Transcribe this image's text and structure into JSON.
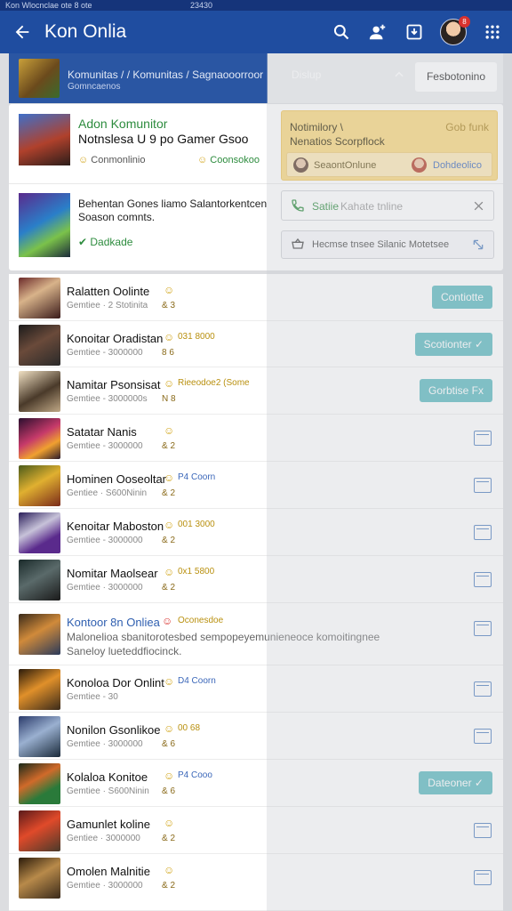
{
  "statusbar": {
    "left": "Kon Wlocnclae ote 8 ote",
    "center": "23430"
  },
  "appbar": {
    "title": "Kon Onlia",
    "notif_count": "8"
  },
  "crumb": {
    "line1": "Komunitas / / Komunitas / Sagnaooorroor",
    "line2": "Gomncaenos",
    "display": "Dislup",
    "button": "Fesbotonino"
  },
  "card": {
    "title_green": "Adon Komunitor",
    "title_main": "Notnslesa U 9 po Gamer Gsoo",
    "status_left": "Conmonlinio",
    "status_right": "Coonsokoo",
    "desc1": "Behentan Gones liamo Salantorkentcen",
    "desc2": "Soason comnts.",
    "ok_label": "Dadkade",
    "notice_title": "Notimilory \\",
    "notice_body": "Nenatios Scorpflock",
    "notice_right": "Gob funk",
    "notice_a": "SeaontOnlune",
    "notice_b": "Dohdeolico",
    "field_label": "Satiie",
    "field_value": "Kahate tnline",
    "field2_label": "Hecmse tnsee Silanic Motetsee"
  },
  "rows": [
    {
      "name": "Ralatten Oolinte",
      "meta": "Gemtiee · 2 Stotinita",
      "stat": "& 3",
      "badge": "",
      "action": "Contiotte"
    },
    {
      "name": "Konoitar Oradistan",
      "meta": "Gemtiee - 3000000",
      "stat": "8 6",
      "badge": "031 8000",
      "action": "Scotionter ✓"
    },
    {
      "name": "Namitar Psonsisat",
      "meta": "Gemtiee - 3000000s",
      "stat": "N 8",
      "badge": "Rieeodoe2 (Some",
      "action": "Gorbtise Fx"
    },
    {
      "name": "Satatar Nanis",
      "meta": "Gemtiee - 3000000",
      "stat": "& 2",
      "badge": "",
      "action": ""
    },
    {
      "name": "Hominen Ooseoltar",
      "meta": "Gentiee · S600Ninin",
      "stat": "& 2",
      "badge": "P4 Coorn",
      "action": ""
    },
    {
      "name": "Kenoitar Maboston",
      "meta": "Gemtiee - 3000000",
      "stat": "& 2",
      "badge": "001 3000",
      "action": ""
    },
    {
      "name": "Nomitar Maolsear",
      "meta": "Gemtiee · 3000000",
      "stat": "& 2",
      "badge": "0x1 5800",
      "action": ""
    },
    {
      "name": "Kontoor 8n Onliea",
      "meta": "Malonelioa sbanitorotesbed sempopeyemunieneoce komoitingnee",
      "meta2": "Saneloy lueteddfiocinck.",
      "stat": "",
      "badge": "Oconesdoe",
      "action": ""
    },
    {
      "name": "Konoloa Dor Onlint",
      "meta": "Gemtiee - 30",
      "stat": "",
      "badge": "D4 Coorn",
      "action": ""
    },
    {
      "name": "Nonilon Gsonlikoe",
      "meta": "Gemtiee · 3000000",
      "stat": "& 6",
      "badge": "00 68",
      "action": ""
    },
    {
      "name": "Kolaloa Konitoe",
      "meta": "Gemtiee · S600Ninin",
      "stat": "& 6",
      "badge": "P4 Cooo",
      "action": "Dateoner ✓"
    },
    {
      "name": "Gamunlet koline",
      "meta": "Gentiee · 3000000",
      "stat": "& 2",
      "badge": "",
      "action": ""
    },
    {
      "name": "Omolen Malnitie",
      "meta": "Gemtiee · 3000000",
      "stat": "& 2",
      "badge": "",
      "action": ""
    }
  ],
  "colors": {
    "appbar": "#1f4da0",
    "accent": "#5ab8bf",
    "notice": "#fbd77a"
  }
}
